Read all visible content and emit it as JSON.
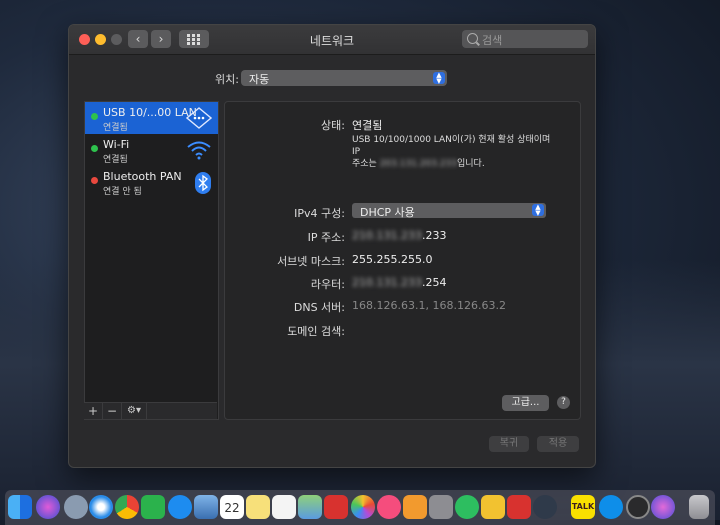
{
  "window": {
    "title": "네트워크",
    "search_placeholder": "검색"
  },
  "location": {
    "label": "위치:",
    "value": "자동"
  },
  "services": [
    {
      "name": "USB 10/...00 LAN",
      "status": "연결됨",
      "status_color": "#2ec24d",
      "selected": true
    },
    {
      "name": "Wi-Fi",
      "status": "연결됨",
      "status_color": "#2ec24d",
      "selected": false
    },
    {
      "name": "Bluetooth PAN",
      "status": "연결 안 됨",
      "status_color": "#e8483e",
      "selected": false
    }
  ],
  "sidebar_footer": {
    "add": "+",
    "remove": "−",
    "gear": "⚙▾"
  },
  "detail": {
    "status_label": "상태:",
    "status_value": "연결됨",
    "description_line1": "USB 10/100/1000 LAN이(가) 현재 활성 상태이며 IP",
    "description_prefix": "주소는 ",
    "description_redacted": "203.131.203.233",
    "description_suffix": "입니다.",
    "ipv4_label": "IPv4 구성:",
    "ipv4_value": "DHCP 사용",
    "ip_label": "IP 주소:",
    "ip_redacted": "210.131.233",
    "ip_visible": ".233",
    "subnet_label": "서브넷 마스크:",
    "subnet_value": "255.255.255.0",
    "router_label": "라우터:",
    "router_redacted": "210.131.233",
    "router_visible": ".254",
    "dns_label": "DNS 서버:",
    "dns_value": "168.126.63.1, 168.126.63.2",
    "domain_label": "도메인 검색:",
    "advanced_button": "고급...",
    "help_button": "?"
  },
  "buttons": {
    "revert": "복귀",
    "apply": "적용"
  },
  "dock": {
    "items": [
      "finder",
      "siri",
      "launchpad",
      "safari",
      "chrome",
      "feedly",
      "app-store",
      "preview",
      "calendar",
      "notes",
      "reminders",
      "maps",
      "photo-booth",
      "photos",
      "itunes",
      "ibooks",
      "system-preferences",
      "evernote",
      "blog",
      "bear",
      "quicktime",
      "kakaotalk",
      "teamviewer",
      "screenshot",
      "siri-2",
      "trash"
    ],
    "calendar_day": "22",
    "kakao_label": "TALK"
  }
}
